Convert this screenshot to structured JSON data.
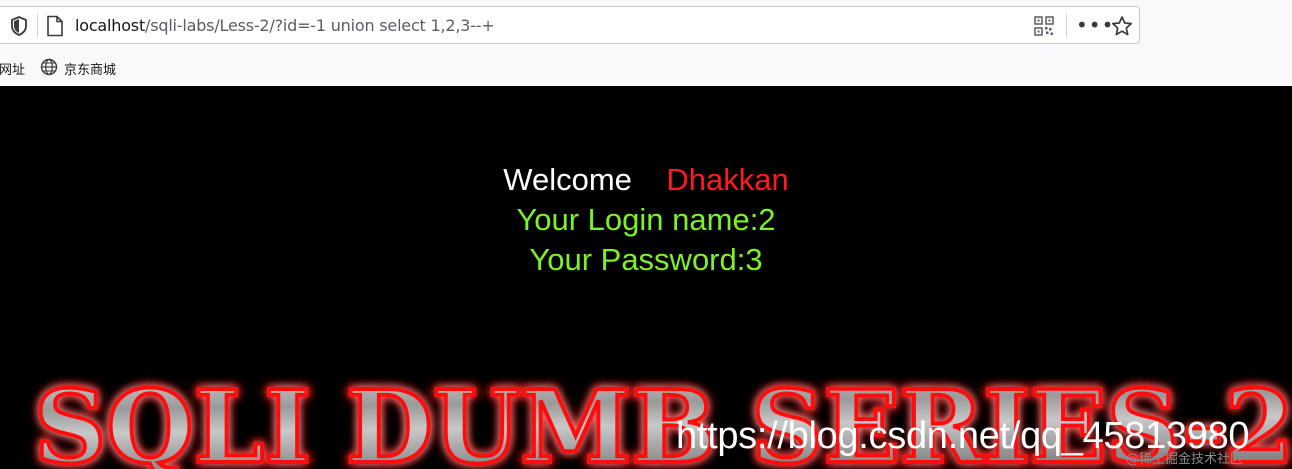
{
  "browser": {
    "url_host": "localhost",
    "url_path": "/sqli-labs/Less-2/?id=-1 union select 1,2,3--+",
    "icons": [
      "shield-icon",
      "page-icon",
      "qr-code-icon",
      "more-menu-icon",
      "bookmark-star-icon",
      "globe-icon"
    ],
    "bookmarks": [
      {
        "label": "网址"
      },
      {
        "label": "京东商城"
      }
    ]
  },
  "page": {
    "welcome_label": "Welcome",
    "welcome_name": "Dhakkan",
    "login_text": "Your Login name:2",
    "password_text": "Your Password:3",
    "banner_text": "SQLI DUMB SERIES-2",
    "watermark": "https://blog.csdn.net/qq_45813980",
    "watermark_small": "@稀土掘金技术社区"
  },
  "colors": {
    "background": "#000000",
    "welcome_white": "#ffffff",
    "name_red": "#ff1a1a",
    "result_green": "#7cf226",
    "banner_glow": "#ff0000"
  }
}
